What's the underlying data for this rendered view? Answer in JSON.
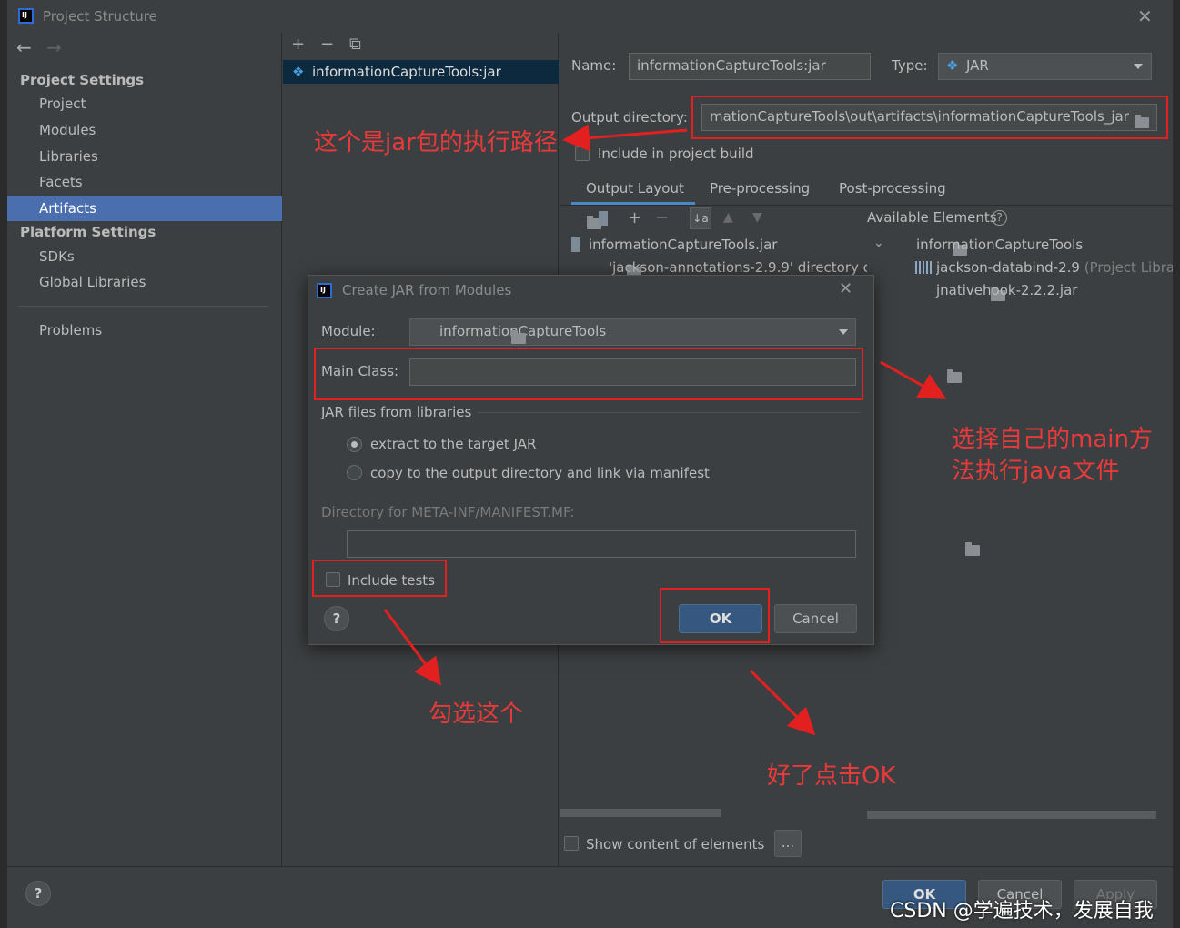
{
  "window": {
    "title": "Project Structure",
    "close_glyph": "✕"
  },
  "nav": {
    "back_glyph": "←",
    "forward_glyph": "→",
    "project_settings_header": "Project Settings",
    "project_settings_items": [
      "Project",
      "Modules",
      "Libraries",
      "Facets",
      "Artifacts"
    ],
    "platform_settings_header": "Platform Settings",
    "platform_settings_items": [
      "SDKs",
      "Global Libraries"
    ],
    "problems": "Problems",
    "selected_item": "Artifacts"
  },
  "middle": {
    "toolbar": [
      "+",
      "−",
      "⧉"
    ],
    "artifact_name": "informationCaptureTools:jar"
  },
  "artifact": {
    "name_label": "Name:",
    "name_value": "informationCaptureTools:jar",
    "type_label": "Type:",
    "type_value": "JAR",
    "output_dir_label": "Output directory:",
    "output_dir_value": "mationCaptureTools\\out\\artifacts\\informationCaptureTools_jar",
    "include_in_build_label": "Include in project build",
    "tabs": [
      "Output Layout",
      "Pre-processing",
      "Post-processing"
    ],
    "active_tab": "Output Layout",
    "available_elements_label": "Available Elements",
    "layout_tree": [
      "informationCaptureTools.jar",
      "'jackson-annotations-2.9.9' directory co"
    ],
    "available_tree": {
      "root": "informationCaptureTools",
      "children": [
        {
          "name": "jackson-databind-2.9",
          "suffix": " (Project Librar"
        },
        {
          "name": "jnativehook-2.2.2.jar",
          "suffix": ""
        }
      ]
    },
    "show_content_label": "Show content of elements",
    "ellipsis_button": "..."
  },
  "footer": {
    "help": "?",
    "ok": "OK",
    "cancel": "Cancel",
    "apply": "Apply"
  },
  "dialog": {
    "title": "Create JAR from Modules",
    "close_glyph": "✕",
    "module_label": "Module:",
    "module_value": "informationCaptureTools",
    "main_class_label": "Main Class:",
    "main_class_value": "",
    "jar_files_label": "JAR files from libraries",
    "radio_extract": "extract to the target JAR",
    "radio_copy": "copy to the output directory and link via manifest",
    "selected_radio": "extract to the target JAR",
    "manifest_dir_label": "Directory for META-INF/MANIFEST.MF:",
    "manifest_dir_value": "",
    "include_tests_label": "Include tests",
    "help": "?",
    "ok": "OK",
    "cancel": "Cancel"
  },
  "annotations": {
    "output_dir_note": "这个是jar包的执行路径",
    "main_class_note_line1": "选择自己的main方",
    "main_class_note_line2": "法执行java文件",
    "include_tests_note": "勾选这个",
    "ok_note": "好了点击OK",
    "accent_color": "#e32020"
  },
  "watermark": "CSDN @学遍技术，发展自我",
  "colors": {
    "background": "#3c3f41",
    "selection": "#4b6eaf",
    "primary_button": "#365880"
  }
}
